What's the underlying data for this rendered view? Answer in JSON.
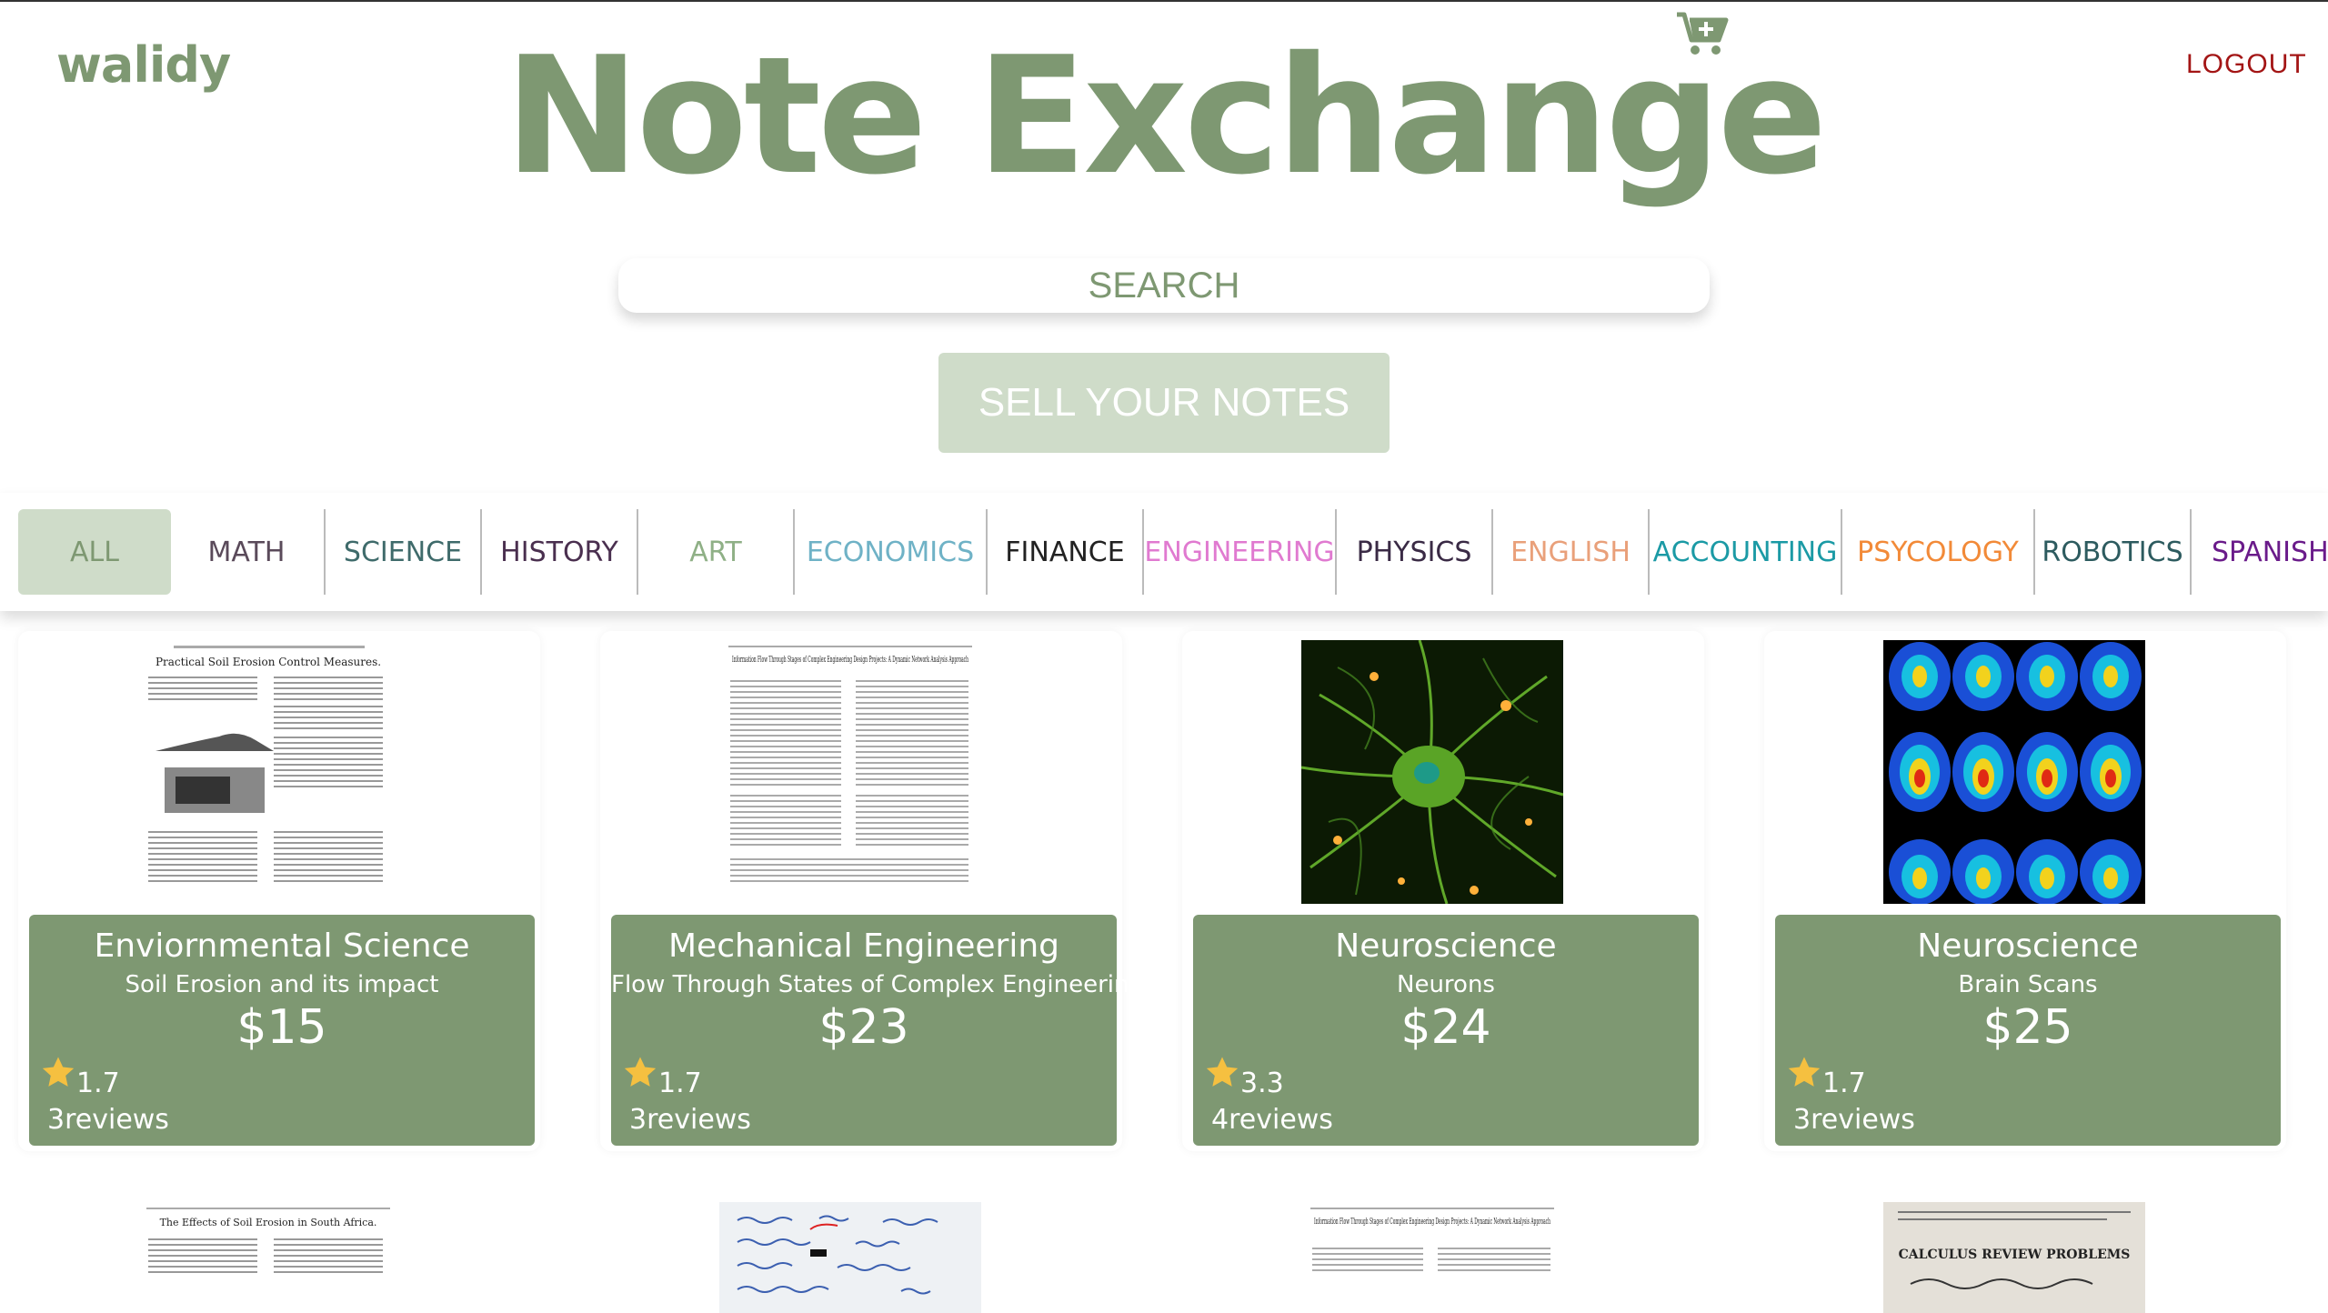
{
  "header": {
    "logo": "walidy",
    "title": "Note Exchange",
    "logout": "LOGOUT",
    "cart_icon": "cart-plus-icon"
  },
  "search": {
    "placeholder": "SEARCH"
  },
  "sell_button": "SELL YOUR NOTES",
  "categories": [
    {
      "label": "ALL",
      "color": "#7e9872",
      "active": true
    },
    {
      "label": "MATH",
      "color": "#5a4a5a"
    },
    {
      "label": "SCIENCE",
      "color": "#3f6b6b"
    },
    {
      "label": "HISTORY",
      "color": "#4a2f4f"
    },
    {
      "label": "ART",
      "color": "#8fb086"
    },
    {
      "label": "ECONOMICS",
      "color": "#6fb2c6"
    },
    {
      "label": "FINANCE",
      "color": "#222222"
    },
    {
      "label": "ENGINEERING",
      "color": "#e07ad0"
    },
    {
      "label": "PHYSICS",
      "color": "#3a2a45"
    },
    {
      "label": "ENGLISH",
      "color": "#e9a07a"
    },
    {
      "label": "ACCOUNTING",
      "color": "#1b9aa5"
    },
    {
      "label": "PSYCOLOGY",
      "color": "#f28a38"
    },
    {
      "label": "ROBOTICS",
      "color": "#2d5b5f"
    },
    {
      "label": "SPANISH",
      "color": "#6a1b8a"
    }
  ],
  "listings": [
    {
      "subject": "Enviornmental Science",
      "description": "Soil Erosion and its impact",
      "price": "$15",
      "rating": "1.7",
      "review_count": "3",
      "review_label": "reviews"
    },
    {
      "subject": "Mechanical Engineering",
      "description": "Flow Through States of Complex Engineering",
      "price": "$23",
      "rating": "1.7",
      "review_count": "3",
      "review_label": "reviews"
    },
    {
      "subject": "Neuroscience",
      "description": "Neurons",
      "price": "$24",
      "rating": "3.3",
      "review_count": "4",
      "review_label": "reviews"
    },
    {
      "subject": "Neuroscience",
      "description": "Brain Scans",
      "price": "$25",
      "rating": "1.7",
      "review_count": "3",
      "review_label": "reviews"
    }
  ],
  "partial_listings": [
    {
      "image_heading": "The Effects of Soil Erosion in South Africa."
    },
    {
      "image_heading": ""
    },
    {
      "image_heading": "Information Flow Through Stages of Complex Engineering Design Projects: A Dynamic Network Analysis Approach"
    },
    {
      "image_heading": "CALCULUS REVIEW PROBLEMS"
    }
  ],
  "thumb_texts": {
    "soil": "Practical Soil Erosion Control Measures.",
    "flow": "Information Flow Through Stages of Complex Engineering Design Projects: A Dynamic Network Analysis Approach"
  },
  "colors": {
    "accent": "#7e9872",
    "accent_light": "#cfdcc9",
    "logout": "#a31515",
    "star": "#f5c040"
  }
}
